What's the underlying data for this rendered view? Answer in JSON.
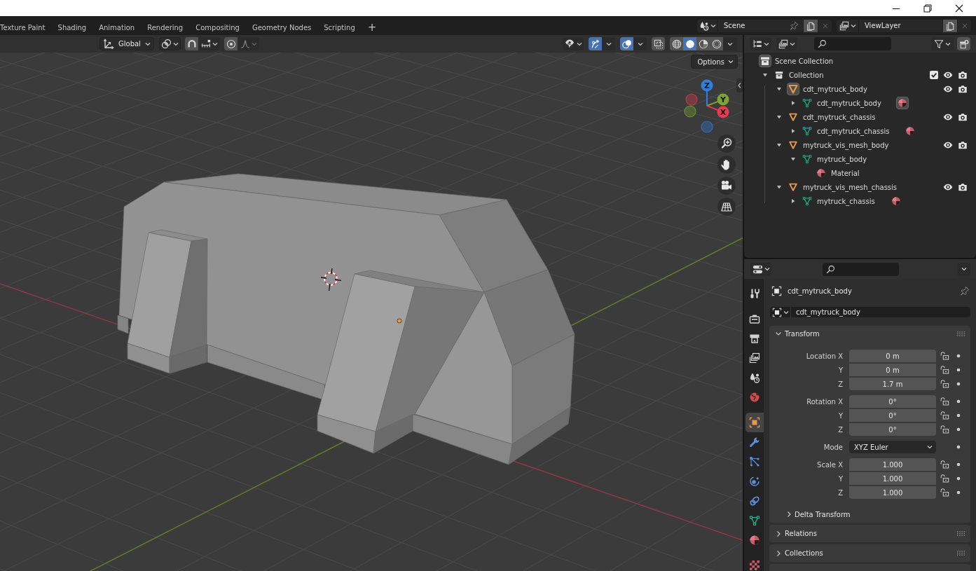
{
  "workspace_tabs": [
    {
      "label": "Texture Paint",
      "selected": false
    },
    {
      "label": "Shading",
      "selected": false
    },
    {
      "label": "Animation",
      "selected": false
    },
    {
      "label": "Rendering",
      "selected": false
    },
    {
      "label": "Compositing",
      "selected": false
    },
    {
      "label": "Geometry Nodes",
      "selected": false
    },
    {
      "label": "Scripting",
      "selected": false
    }
  ],
  "add_workspace": "+",
  "scene": {
    "name": "Scene"
  },
  "view_layer": {
    "name": "ViewLayer"
  },
  "viewport": {
    "orientation": "Global",
    "toggles": [
      {
        "kind": "gizmos",
        "on": true
      },
      {
        "kind": "overlays",
        "on": true
      },
      {
        "kind": "xray",
        "on": false
      }
    ],
    "shading": [
      {
        "kind": "wireframe",
        "selected": false
      },
      {
        "kind": "solid",
        "selected": true
      },
      {
        "kind": "material",
        "selected": false
      },
      {
        "kind": "rendered",
        "selected": false
      }
    ],
    "options": "Options",
    "axes": [
      {
        "label": "Z",
        "color": "#2f7fde"
      },
      {
        "label": "Y",
        "color": "#7ea52e"
      },
      {
        "label": "X",
        "color": "#e8394f"
      }
    ]
  },
  "outliner": {
    "tree": [
      {
        "label": "Scene Collection",
        "kind": "scene_collection",
        "children": [
          {
            "label": "Collection",
            "kind": "collection",
            "expanded": true,
            "checked": true,
            "visible": true,
            "renderable": true,
            "children": [
              {
                "label": "cdt_mytruck_body",
                "kind": "object",
                "active": true,
                "expanded": true,
                "visible": true,
                "renderable": true,
                "children": [
                  {
                    "label": "cdt_mytruck_body",
                    "kind": "mesh",
                    "expanded": false,
                    "badges": [
                      {
                        "kind": "material",
                        "active": true
                      }
                    ]
                  }
                ]
              },
              {
                "label": "cdt_mytruck_chassis",
                "kind": "object",
                "active": false,
                "expanded": true,
                "visible": true,
                "renderable": true,
                "children": [
                  {
                    "label": "cdt_mytruck_chassis",
                    "kind": "mesh",
                    "expanded": false,
                    "badges": [
                      {
                        "kind": "material",
                        "active": false
                      }
                    ]
                  }
                ]
              },
              {
                "label": "mytruck_vis_mesh_body",
                "kind": "object",
                "active": false,
                "expanded": true,
                "visible": true,
                "renderable": true,
                "children": [
                  {
                    "label": "mytruck_body",
                    "kind": "mesh",
                    "expanded": true,
                    "children": [
                      {
                        "label": "Material",
                        "kind": "material"
                      }
                    ]
                  }
                ]
              },
              {
                "label": "mytruck_vis_mesh_chassis",
                "kind": "object",
                "active": false,
                "expanded": true,
                "visible": true,
                "renderable": true,
                "children": [
                  {
                    "label": "mytruck_chassis",
                    "kind": "mesh",
                    "expanded": false,
                    "badges": [
                      {
                        "kind": "material",
                        "active": false
                      }
                    ]
                  }
                ]
              }
            ]
          }
        ]
      }
    ]
  },
  "properties": {
    "tab_groups": [
      {
        "tabs": [
          {
            "kind": "tool",
            "selected": false
          }
        ]
      },
      {
        "tabs": [
          {
            "kind": "render",
            "selected": false
          },
          {
            "kind": "output",
            "selected": false
          },
          {
            "kind": "view_layer",
            "selected": false
          },
          {
            "kind": "scene",
            "selected": false
          },
          {
            "kind": "world",
            "selected": false
          }
        ]
      },
      {
        "tabs": [
          {
            "kind": "object",
            "selected": true
          },
          {
            "kind": "modifiers",
            "selected": false
          },
          {
            "kind": "particles",
            "selected": false
          },
          {
            "kind": "physics",
            "selected": false
          },
          {
            "kind": "constraints",
            "selected": false
          },
          {
            "kind": "data",
            "selected": false
          },
          {
            "kind": "material",
            "selected": false
          }
        ]
      },
      {
        "tabs": [
          {
            "kind": "texture",
            "selected": false
          }
        ]
      }
    ],
    "context": "cdt_mytruck_body",
    "object_name": "cdt_mytruck_body",
    "panels": [
      {
        "title": "Transform",
        "expanded": true,
        "groups": [
          {
            "rows": [
              {
                "label": "Location X",
                "kind": "number",
                "value": "0 m",
                "locked": false
              },
              {
                "label": "Y",
                "kind": "number",
                "value": "0 m",
                "locked": false
              },
              {
                "label": "Z",
                "kind": "number",
                "value": "1.7 m",
                "locked": false
              }
            ]
          },
          {
            "rows": [
              {
                "label": "Rotation X",
                "kind": "number",
                "value": "0°",
                "locked": false
              },
              {
                "label": "Y",
                "kind": "number",
                "value": "0°",
                "locked": false
              },
              {
                "label": "Z",
                "kind": "number",
                "value": "0°",
                "locked": false
              }
            ]
          },
          {
            "rows": [
              {
                "label": "Mode",
                "kind": "dropdown",
                "value": "XYZ Euler"
              }
            ]
          },
          {
            "rows": [
              {
                "label": "Scale X",
                "kind": "number",
                "value": "1.000",
                "locked": false
              },
              {
                "label": "Y",
                "kind": "number",
                "value": "1.000",
                "locked": false
              },
              {
                "label": "Z",
                "kind": "number",
                "value": "1.000",
                "locked": false
              }
            ]
          }
        ],
        "subpanels": [
          {
            "title": "Delta Transform",
            "expanded": false
          }
        ]
      },
      {
        "title": "Relations",
        "expanded": false
      },
      {
        "title": "Collections",
        "expanded": false
      }
    ]
  }
}
